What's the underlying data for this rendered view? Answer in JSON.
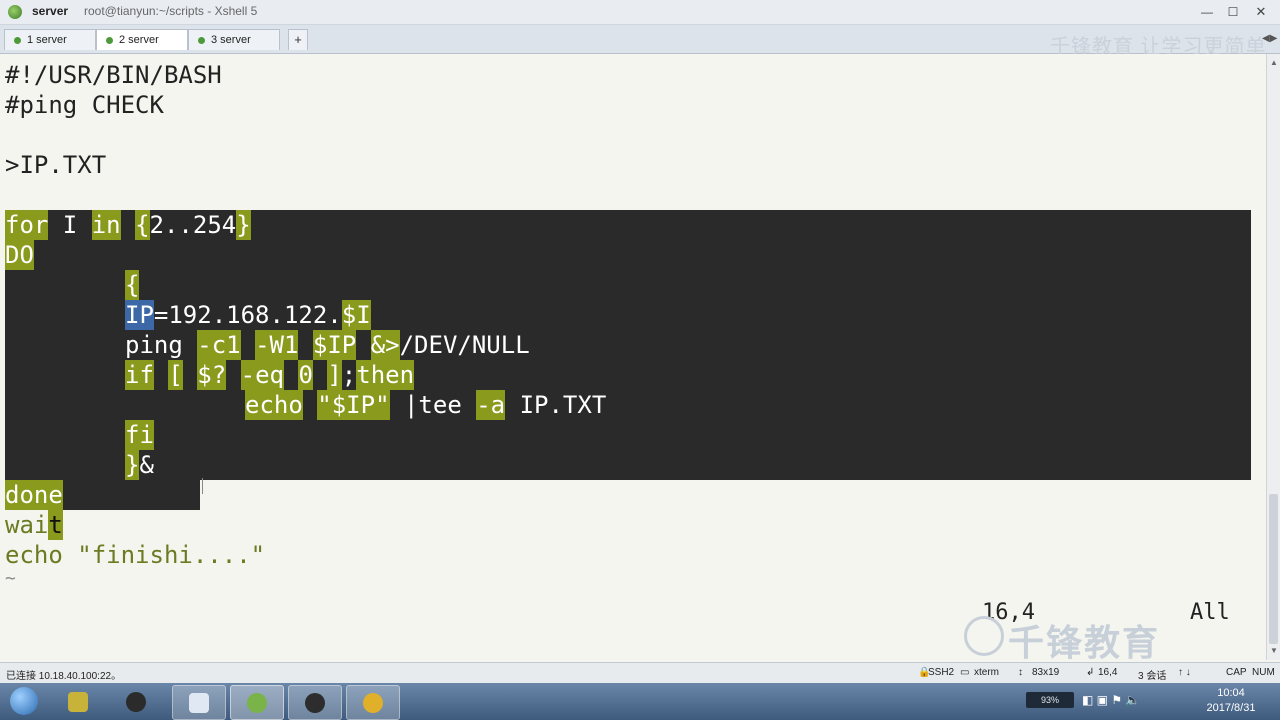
{
  "window": {
    "title_main": "server",
    "title_sub": "root@tianyun:~/scripts - Xshell 5",
    "min_glyph": "—",
    "max_glyph": "☐",
    "close_glyph": "✕"
  },
  "tabs": [
    {
      "label": "1 server",
      "active": false
    },
    {
      "label": "2 server",
      "active": true
    },
    {
      "label": "3 server",
      "active": false
    }
  ],
  "tab_add": "+",
  "tab_nav": "◀▶",
  "terminal": {
    "line1": "#!/USR/BIN/BASH",
    "line2": "#ping CHECK",
    "line3": ">IP.TXT",
    "for_kw": "for",
    "for_var": " I ",
    "in_kw": "in",
    "range_open": "{",
    "range_body": "2..254",
    "range_close": "}",
    "do_kw": "DO",
    "brace_open": "{",
    "ip_var": "IP",
    "ip_value": "=192.168.122.",
    "ip_dollar": "$I",
    "ping_cmd": "ping ",
    "ping_c": "-c1",
    "ping_w": "-W1",
    "ping_ip": "$IP",
    "ping_redir": "&>",
    "ping_null": "/DEV/NULL",
    "if_kw": "if",
    "if_bracket": "[",
    "if_status": "$?",
    "if_eq": "-eq",
    "if_zero": "0",
    "if_close": "]",
    "if_semi": ";",
    "then_kw": "then",
    "echo_kw": "echo",
    "echo_q1": "\"",
    "echo_var": "$IP",
    "echo_q2": "\"",
    "pipe_tee": "|tee",
    "tee_a": "-a",
    "tee_file": "IP.TXT",
    "fi_kw": "fi",
    "brace_close": "}",
    "amp": "&",
    "done_kw": "done",
    "wait_a": "wai",
    "wait_b": "t",
    "echo2_kw": "echo",
    "echo2_str": "\"finishi....\"",
    "tilde": "~",
    "ruler_pos": "16,4",
    "ruler_all": "All"
  },
  "watermark": {
    "brand": "千锋教育",
    "corner": "千锋教育 让学习更简单"
  },
  "status": {
    "connected": "已连接 10.18.40.100:22。",
    "protocol": "SSH2",
    "term": "xterm",
    "size": "83x19",
    "cursor": "16,4",
    "sessions": "3 会话",
    "caps": "CAP",
    "num": "NUM"
  },
  "taskbar": {
    "tray_label": "93%",
    "time": "10:04",
    "date": "2017/8/31"
  },
  "colors": {
    "highlight": "#8a9a1c",
    "selection": "#2a2a2a",
    "var_highlight": "#3c68a8"
  }
}
